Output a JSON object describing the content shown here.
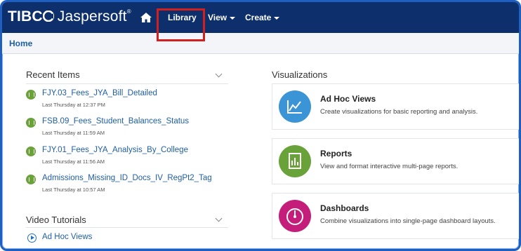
{
  "brand": {
    "logo_text": "TIBC",
    "logo_rest": "Jaspersoft",
    "trademark": "®"
  },
  "nav": {
    "home_icon": "home-icon",
    "library_label": "Library",
    "view_label": "View",
    "create_label": "Create"
  },
  "breadcrumb": {
    "label": "Home"
  },
  "recent": {
    "heading": "Recent Items",
    "items": [
      {
        "title": "FJY.03_Fees_JYA_Bill_Detailed",
        "time": "Last Thursday at 12:37 PM"
      },
      {
        "title": "FSB.09_Fees_Student_Balances_Status",
        "time": "Last Thursday at 11:59 AM"
      },
      {
        "title": "FJY.01_Fees_JYA_Analysis_By_College",
        "time": "Last Thursday at 11:56 AM"
      },
      {
        "title": "Admissions_Missing_ID_Docs_IV_RegPt2_Tag",
        "time": "Last Thursday at 10:57 AM"
      }
    ]
  },
  "videos": {
    "heading": "Video Tutorials",
    "items": [
      {
        "label": "Ad Hoc Views"
      }
    ]
  },
  "visualizations": {
    "heading": "Visualizations",
    "cards": [
      {
        "title": "Ad Hoc Views",
        "desc": "Create visualizations for basic reporting and analysis.",
        "icon": "line-chart-icon",
        "color": "#3a94d6"
      },
      {
        "title": "Reports",
        "desc": "View and format interactive multi-page reports.",
        "icon": "report-icon",
        "color": "#6aa23a"
      },
      {
        "title": "Dashboards",
        "desc": "Combine visualizations into single-page dashboard layouts.",
        "icon": "gauge-icon",
        "color": "#c41e7a"
      }
    ]
  },
  "colors": {
    "navbar": "#0d2f6b",
    "link": "#1f5fa3",
    "highlight": "#d41f1f"
  }
}
